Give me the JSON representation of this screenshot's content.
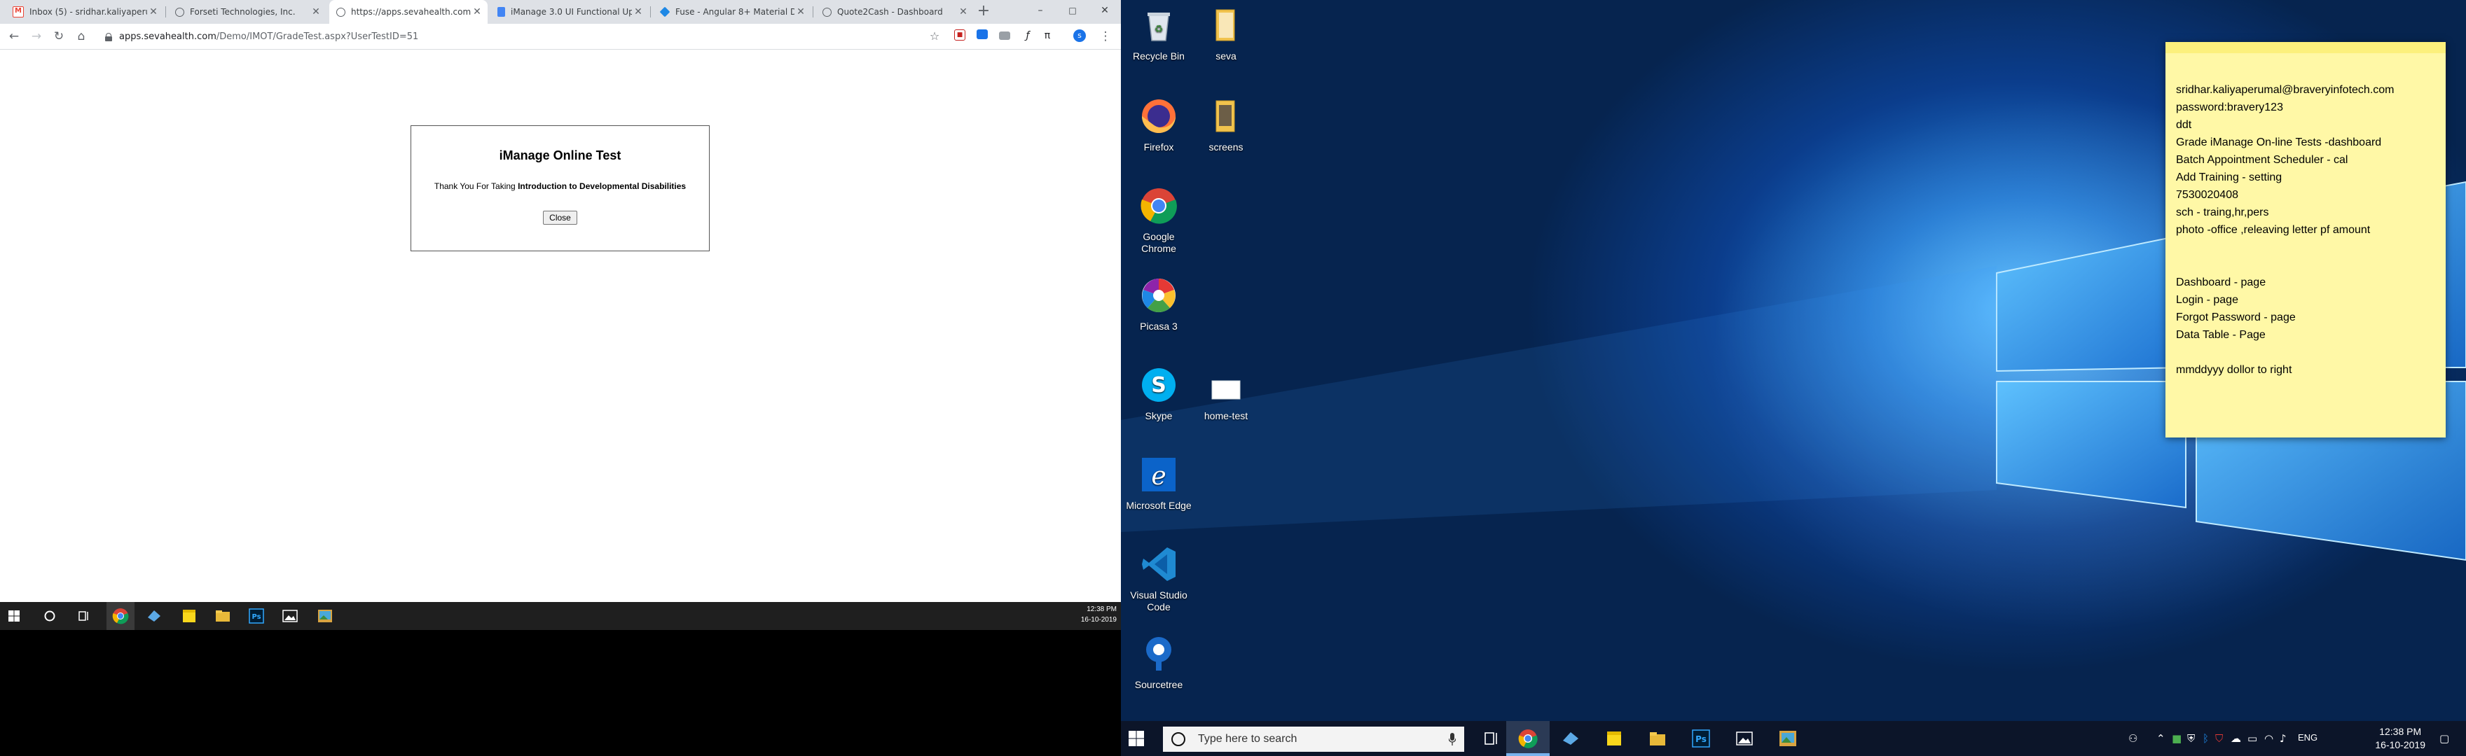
{
  "browser": {
    "tabs": [
      {
        "title": "Inbox (5) - sridhar.kaliyaperum",
        "favicon": "gmail-icon",
        "color": "#ea4335"
      },
      {
        "title": "Forseti Technologies, Inc.",
        "favicon": "globe-icon",
        "color": "#5f6368"
      },
      {
        "title": "https://apps.sevahealth.com/D",
        "favicon": "globe-icon",
        "color": "#5f6368"
      },
      {
        "title": "iManage 3.0 UI Functional Upd",
        "favicon": "docs-icon",
        "color": "#4285f4"
      },
      {
        "title": "Fuse - Angular 8+ Material De",
        "favicon": "diamond-icon",
        "color": "#1e88e5"
      },
      {
        "title": "Quote2Cash - Dashboard",
        "favicon": "globe-icon",
        "color": "#5f6368"
      }
    ],
    "new_tab": "+",
    "url_host": "apps.sevahealth.com",
    "url_path": "/Demo/IMOT/GradeTest.aspx?UserTestID=51",
    "window_controls": {
      "minimize": "–",
      "maximize": "□",
      "close": "✕"
    }
  },
  "dialog": {
    "title": "iManage Online Test",
    "message_prefix": "Thank You For Taking ",
    "message_bold": "Introduction to Developmental Disabilities",
    "close_label": "Close"
  },
  "taskbar_left": {
    "time": "12:38 PM",
    "date": "16-10-2019"
  },
  "desktop": {
    "icons": [
      {
        "label": "Recycle Bin",
        "icon": "recycle-bin-icon"
      },
      {
        "label": "seva",
        "icon": "folder-icon"
      },
      {
        "label": "Firefox",
        "icon": "firefox-icon"
      },
      {
        "label": "screens",
        "icon": "folder-icon"
      },
      {
        "label": "Google Chrome",
        "icon": "chrome-icon"
      },
      {
        "label": "Picasa 3",
        "icon": "picasa-icon"
      },
      {
        "label": "Skype",
        "icon": "skype-icon"
      },
      {
        "label": "home-test",
        "icon": "image-file-icon"
      },
      {
        "label": "Microsoft Edge",
        "icon": "edge-icon"
      },
      {
        "label": "Visual Studio Code",
        "icon": "vscode-icon"
      },
      {
        "label": "Sourcetree",
        "icon": "sourcetree-icon"
      }
    ]
  },
  "sticky_note": {
    "lines": [
      "sridhar.kaliyaperumal@braveryinfotech.com",
      "password:bravery123",
      "ddt",
      "Grade iManage On-line Tests -dashboard",
      "Batch Appointment Scheduler - cal",
      "Add Training - setting",
      "7530020408",
      "sch - traing,hr,pers",
      "photo -office ,releaving letter pf amount",
      "",
      "",
      "Dashboard - page",
      "Login - page",
      "Forgot Password - page",
      "Data Table - Page",
      "",
      "mmddyyy dollor to right"
    ],
    "color": "#fff8a6"
  },
  "taskbar_right": {
    "search_placeholder": "Type here to search",
    "language": "ENG",
    "time": "12:38 PM",
    "date": "16-10-2019"
  },
  "colors": {
    "taskbar_dark": "#0c1529",
    "wallpaper_blue": "#1f76d1",
    "accent": "#78b3ee"
  }
}
